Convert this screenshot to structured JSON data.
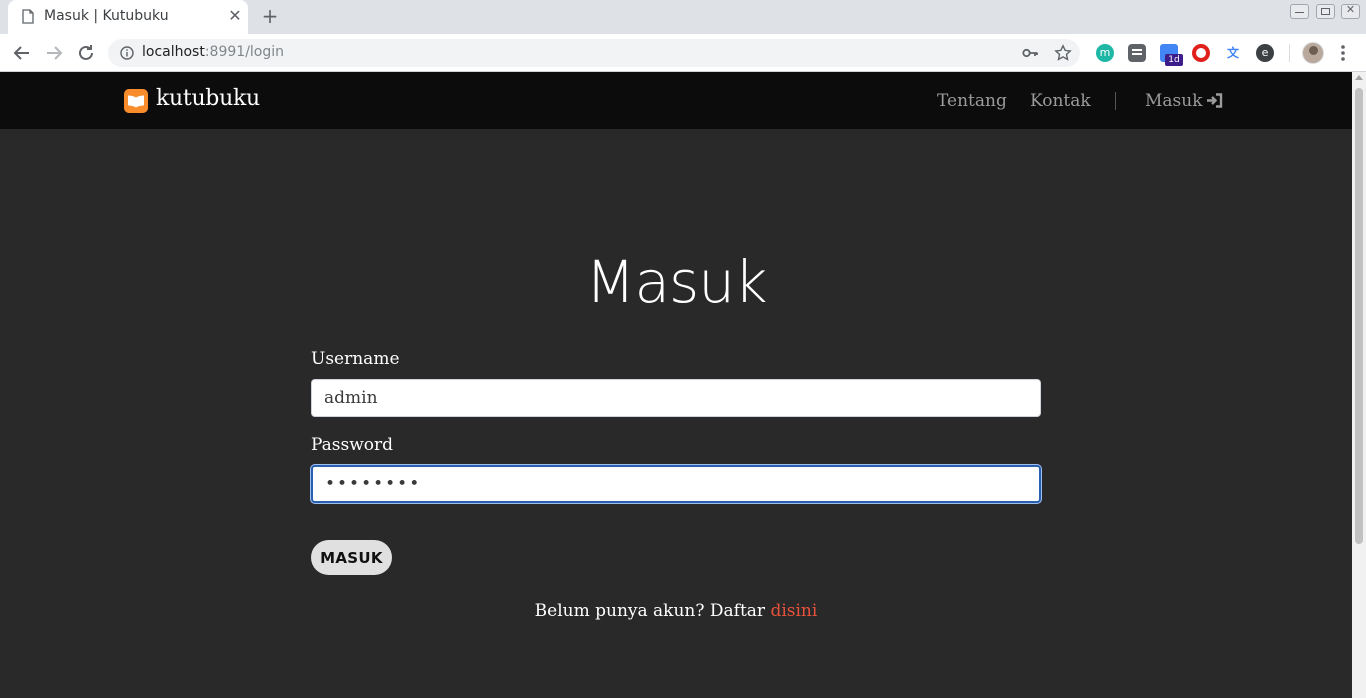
{
  "browser": {
    "tab": {
      "title": "Masuk | Kutubuku",
      "close": "✕"
    },
    "new_tab": "+",
    "url": {
      "host": "localhost",
      "rest": ":8991/login"
    },
    "extensions": {
      "m": "m",
      "calendar_badge": "1d",
      "translate": "文",
      "e": "e"
    }
  },
  "navbar": {
    "brand": "kutubuku",
    "links": {
      "tentang": "Tentang",
      "kontak": "Kontak",
      "masuk": "Masuk"
    }
  },
  "login": {
    "heading": "Masuk",
    "username_label": "Username",
    "username_value": "admin",
    "password_label": "Password",
    "password_value": "••••••••",
    "submit_label": "MASUK",
    "signup_prefix": "Belum punya akun? Daftar ",
    "signup_link": "disini"
  },
  "colors": {
    "navbar_bg": "#0c0c0c",
    "page_bg": "#292929",
    "brand_accent": "#f98c2b",
    "link_accent": "#e8513b",
    "focus_border": "#2a5fb0"
  }
}
